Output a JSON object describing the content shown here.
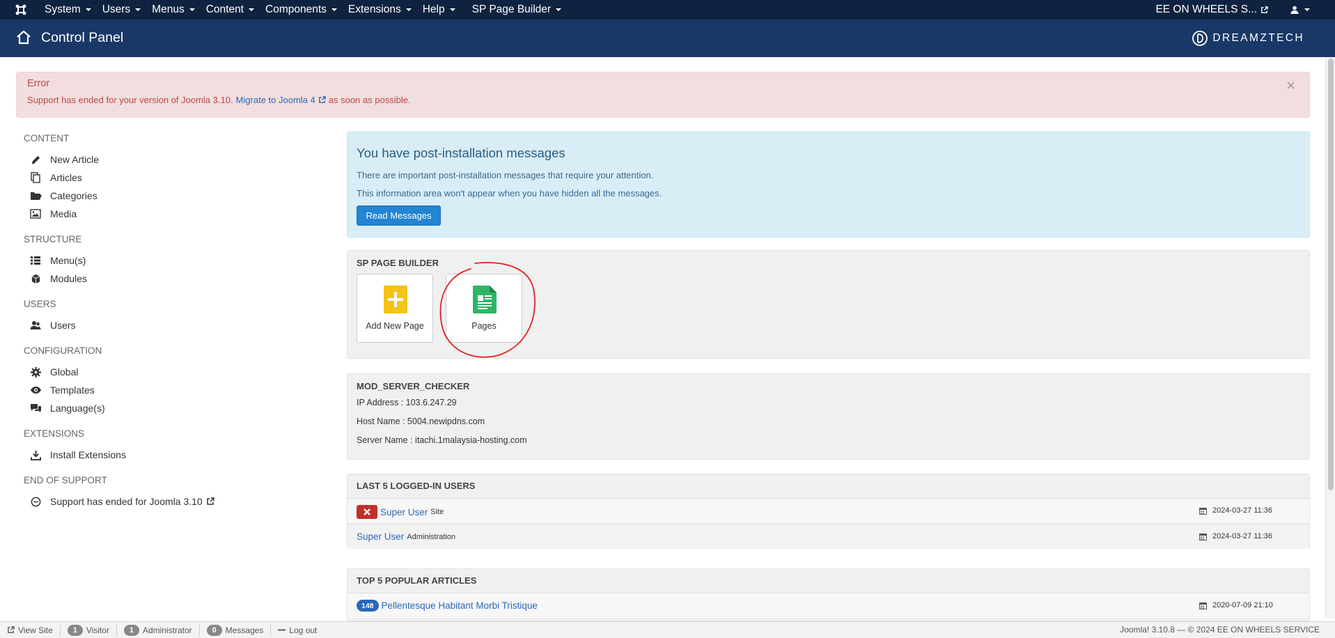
{
  "navbar": {
    "menu": [
      "System",
      "Users",
      "Menus",
      "Content",
      "Components",
      "Extensions",
      "Help",
      "SP Page Builder"
    ],
    "site_name": "EE ON WHEELS S...",
    "colors": {
      "navbar_bg": "#0f2340",
      "header_bg": "#1a3867"
    }
  },
  "header": {
    "title": "Control Panel",
    "brand": "DREAMZTECH"
  },
  "alert": {
    "title": "Error",
    "message_before": "Support has ended for your version of Joomla 3.10.",
    "link": "Migrate to Joomla 4",
    "message_after": "as soon as possible.",
    "close": "×"
  },
  "sidebar": {
    "sections": [
      {
        "heading": "CONTENT",
        "items": [
          {
            "label": "New Article",
            "icon": "pencil-icon"
          },
          {
            "label": "Articles",
            "icon": "copy-icon"
          },
          {
            "label": "Categories",
            "icon": "folder-open-icon"
          },
          {
            "label": "Media",
            "icon": "image-icon"
          }
        ]
      },
      {
        "heading": "STRUCTURE",
        "items": [
          {
            "label": "Menu(s)",
            "icon": "list-icon"
          },
          {
            "label": "Modules",
            "icon": "cube-icon"
          }
        ]
      },
      {
        "heading": "USERS",
        "items": [
          {
            "label": "Users",
            "icon": "users-icon"
          }
        ]
      },
      {
        "heading": "CONFIGURATION",
        "items": [
          {
            "label": "Global",
            "icon": "cog-icon"
          },
          {
            "label": "Templates",
            "icon": "eye-icon"
          },
          {
            "label": "Language(s)",
            "icon": "comments-icon"
          }
        ]
      },
      {
        "heading": "EXTENSIONS",
        "items": [
          {
            "label": "Install Extensions",
            "icon": "download-icon"
          }
        ]
      },
      {
        "heading": "END OF SUPPORT",
        "items": [
          {
            "label": "Support has ended for Joomla 3.10",
            "icon": "minus-circle-icon"
          }
        ]
      }
    ]
  },
  "postinstall": {
    "title": "You have post-installation messages",
    "line1": "There are important post-installation messages that require your attention.",
    "line2": "This information area won't appear when you have hidden all the messages.",
    "button": "Read Messages"
  },
  "sppb": {
    "heading": "SP PAGE BUILDER",
    "items": [
      {
        "label": "Add New Page",
        "icon": "add-page-icon",
        "color": "#f4c316"
      },
      {
        "label": "Pages",
        "icon": "pages-icon",
        "color": "#2fb567"
      }
    ]
  },
  "server": {
    "heading": "MOD_SERVER_CHECKER",
    "ip": "IP Address : 103.6.247.29",
    "host": "Host Name : 5004.newipdns.com",
    "server": "Server Name : itachi.1malaysia-hosting.com"
  },
  "logged": {
    "heading": "LAST 5 LOGGED-IN USERS",
    "rows": [
      {
        "name": "Super User",
        "where": "Site",
        "date": "2024-03-27 11:36"
      },
      {
        "name": "Super User",
        "where": "Administration",
        "date": "2024-03-27 11:36"
      }
    ]
  },
  "popular": {
    "heading": "TOP 5 POPULAR ARTICLES",
    "rows": [
      {
        "hits": "148",
        "title": "Pellentesque Habitant Morbi Tristique",
        "date": "2020-07-09 21:10"
      }
    ]
  },
  "statusbar": {
    "view_site": "View Site",
    "visitor_count": "1",
    "visitor": "Visitor",
    "admin_count": "1",
    "admin": "Administrator",
    "messages_count": "0",
    "messages": "Messages",
    "logout": "Log out",
    "copyright": "Joomla! 3.10.8  —  © 2024 EE ON WHEELS SERVICE"
  }
}
